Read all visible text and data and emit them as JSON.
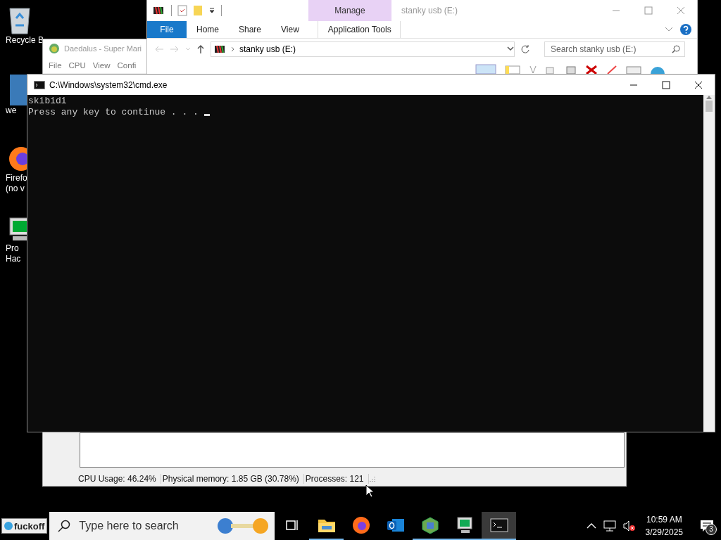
{
  "desktop_icons": [
    {
      "kind": "recycle-bin",
      "lines": [
        "Recycle B"
      ]
    },
    {
      "kind": "photo",
      "lines": [
        "we"
      ]
    },
    {
      "kind": "firefox",
      "lines": [
        "Firefo",
        "(no v"
      ]
    },
    {
      "kind": "monitor",
      "lines": [
        "Pro",
        "Hac"
      ]
    }
  ],
  "daedalus": {
    "title": "Daedalus - Super Mari",
    "menu": [
      "File",
      "CPU",
      "View",
      "Confi"
    ],
    "status": [
      "CPU Usage: 46.24%",
      "Physical memory: 1.85 GB (30.78%)",
      "Processes: 121"
    ]
  },
  "explorer": {
    "title": "stanky usb (E:)",
    "context_tab": "Manage",
    "tabs": [
      {
        "label": "File",
        "kind": "file"
      },
      {
        "label": "Home",
        "kind": "tab"
      },
      {
        "label": "Share",
        "kind": "tab"
      },
      {
        "label": "View",
        "kind": "tab"
      },
      {
        "label": "Application Tools",
        "kind": "context"
      }
    ],
    "address": "stanky usb (E:)",
    "search": {
      "placeholder": "Search stanky usb (E:)"
    }
  },
  "cmd": {
    "title": "C:\\Windows\\system32\\cmd.exe",
    "lines": [
      "skibidi",
      "Press any key to continue . . ."
    ]
  },
  "taskbar": {
    "start": "fuckoff",
    "search": {
      "placeholder": "Type here to search"
    },
    "apps": [
      {
        "kind": "task-view",
        "running": false,
        "selected": false
      },
      {
        "kind": "folder",
        "running": true,
        "selected": false
      },
      {
        "kind": "firefox",
        "running": false,
        "selected": false
      },
      {
        "kind": "mail",
        "running": false,
        "selected": false
      },
      {
        "kind": "chip",
        "running": true,
        "selected": false
      },
      {
        "kind": "monitor",
        "running": true,
        "selected": false
      },
      {
        "kind": "console",
        "running": true,
        "selected": true
      }
    ],
    "volume_muted": true,
    "clock": {
      "time": "10:59 AM",
      "date": "3/29/2025"
    },
    "notifications": "3"
  }
}
